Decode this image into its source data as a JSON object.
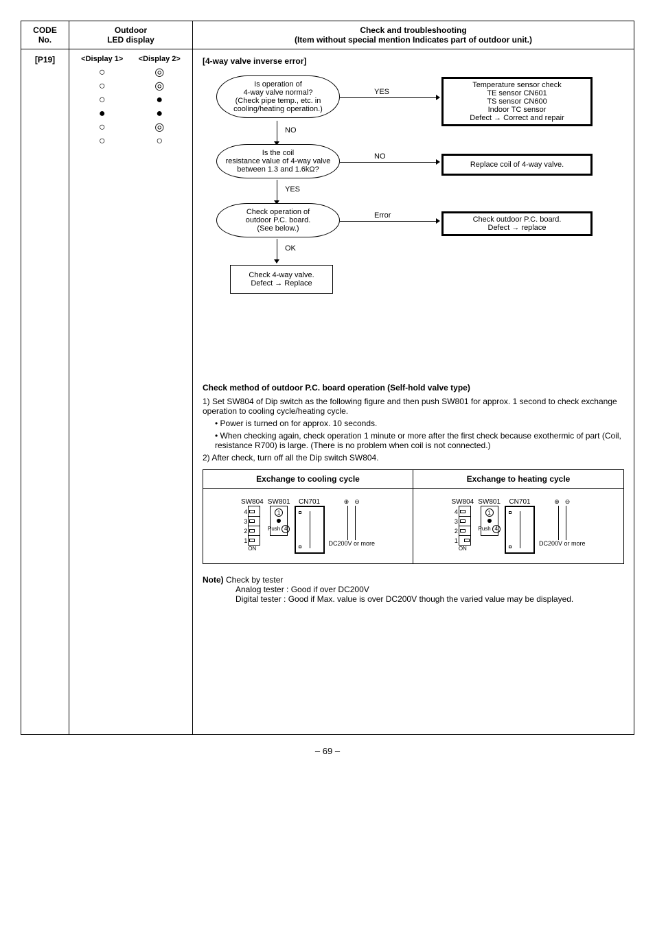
{
  "header": {
    "code_no": "CODE\nNo.",
    "outdoor_led": "Outdoor\nLED display",
    "check": "Check and troubleshooting\n(Item without special mention Indicates part of outdoor unit.)"
  },
  "code": "[P19]",
  "display_labels": {
    "d1": "<Display 1>",
    "d2": "<Display 2>"
  },
  "led_rows": [
    {
      "d1": "○",
      "d2": "◎"
    },
    {
      "d1": "○",
      "d2": "◎"
    },
    {
      "d1": "○",
      "d2": "●"
    },
    {
      "d1": "●",
      "d2": "●"
    },
    {
      "d1": "○",
      "d2": "◎"
    },
    {
      "d1": "○",
      "d2": "○"
    }
  ],
  "section_title": "[4-way valve inverse error]",
  "flow": {
    "q1": "Is operation of\n4-way valve normal?\n(Check pipe temp., etc. in\ncooling/heating operation.)",
    "q1_yes": "YES",
    "q1_no": "NO",
    "r1": "Temperature sensor check\nTE sensor CN601\nTS sensor CN600\nIndoor TC sensor\nDefect → Correct and repair",
    "q2": "Is the coil\nresistance value of 4-way valve\nbetween 1.3 and 1.6kΩ?",
    "q2_no": "NO",
    "q2_yes": "YES",
    "r2": "Replace coil of 4-way valve.",
    "q3": "Check operation of\noutdoor P.C. board.\n(See below.)",
    "q3_err": "Error",
    "q3_ok": "OK",
    "r3": "Check outdoor P.C. board.\nDefect → replace",
    "r4": "Check 4-way valve.\nDefect → Replace"
  },
  "method": {
    "title": "Check method of outdoor P.C. board operation (Self-hold valve type)",
    "li1": "1) Set SW804 of Dip switch as the following figure and then push SW801 for approx. 1 second to check exchange operation to cooling cycle/heating cycle.",
    "li1a": "• Power is turned on for approx. 10 seconds.",
    "li1b": "• When checking again, check operation 1 minute or more after the first check because exothermic of part (Coil, resistance R700) is large. (There is no problem when coil is not connected.)",
    "li2": "2) After check, turn off all the Dip switch SW804."
  },
  "exchange": {
    "cool": "Exchange to cooling cycle",
    "heat": "Exchange to heating cycle",
    "sw804": "SW804",
    "sw801": "SW801",
    "cn701": "CN701",
    "on": "ON",
    "push": "Push",
    "one": "1",
    "four": "4",
    "dc": "DC200V or more"
  },
  "note": {
    "label": "Note)",
    "l1": "Check by tester",
    "l2": "Analog tester : Good if over DC200V",
    "l3": "Digital tester  : Good if Max. value is over DC200V though the varied value may be displayed."
  },
  "page": "– 69 –"
}
